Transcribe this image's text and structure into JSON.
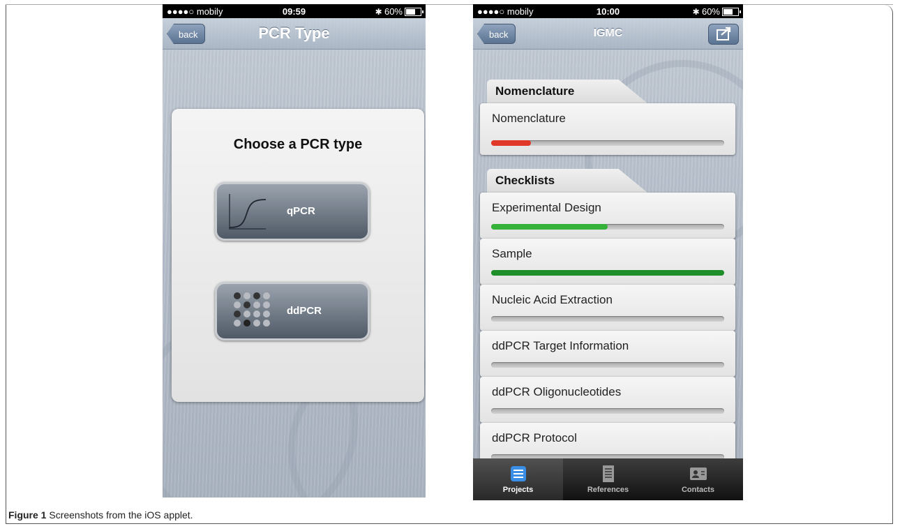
{
  "figure": {
    "label": "Figure 1",
    "caption": "Screenshots from the iOS applet."
  },
  "left_screen": {
    "status": {
      "carrier": "●●●●○ mobily",
      "time": "09:59",
      "battery": "60%"
    },
    "nav": {
      "back_label": "back",
      "title": "PCR Type"
    },
    "card_title": "Choose a PCR type",
    "buttons": [
      {
        "label": "qPCR",
        "icon": "amplification-curve-icon"
      },
      {
        "label": "ddPCR",
        "icon": "droplet-grid-icon"
      }
    ]
  },
  "right_screen": {
    "status": {
      "carrier": "●●●●○ mobily",
      "time": "10:00",
      "battery": "60%"
    },
    "nav": {
      "back_label": "back",
      "title": "IGMC",
      "action_icon": "share-icon"
    },
    "sections": [
      {
        "title": "Nomenclature",
        "items": [
          {
            "label": "Nomenclature",
            "progress": 0.17,
            "color": "#e0392a"
          }
        ]
      },
      {
        "title": "Checklists",
        "items": [
          {
            "label": "Experimental Design",
            "progress": 0.5,
            "color": "#35b23a"
          },
          {
            "label": "Sample",
            "progress": 1.0,
            "color": "#1f8f2a"
          },
          {
            "label": "Nucleic Acid Extraction",
            "progress": 0,
            "color": "#35b23a"
          },
          {
            "label": "ddPCR Target Information",
            "progress": 0,
            "color": "#35b23a"
          },
          {
            "label": "ddPCR Oligonucleotides",
            "progress": 0,
            "color": "#35b23a"
          },
          {
            "label": "ddPCR Protocol",
            "progress": 0,
            "color": "#35b23a"
          }
        ]
      }
    ],
    "tabs": [
      {
        "label": "Projects",
        "icon": "projects-icon",
        "active": true
      },
      {
        "label": "References",
        "icon": "references-icon",
        "active": false
      },
      {
        "label": "Contacts",
        "icon": "contacts-icon",
        "active": false
      }
    ]
  }
}
